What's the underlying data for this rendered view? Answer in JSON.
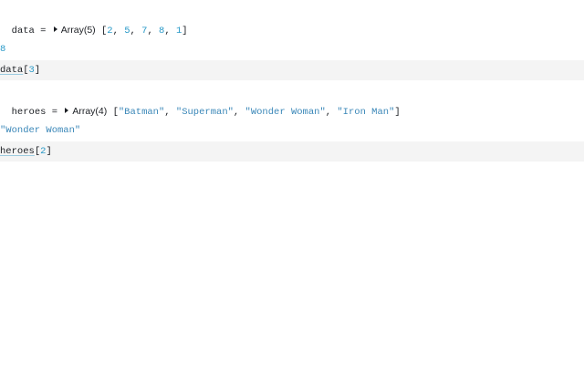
{
  "cells": [
    {
      "output": {
        "name": "data",
        "eq": " = ",
        "summary": "Array(5)",
        "open": "[",
        "values": [
          "2",
          "5",
          "7",
          "8",
          "1"
        ],
        "sep": ", ",
        "close": "]"
      },
      "result": "8",
      "input": {
        "var": "data",
        "index": "3"
      }
    },
    {
      "output": {
        "name": "heroes",
        "eq": " = ",
        "summary": "Array(4)",
        "open": "[",
        "values": [
          "\"Batman\"",
          "\"Superman\"",
          "\"Wonder Woman\"",
          "\"Iron Man\""
        ],
        "sep": ", ",
        "close": "]"
      },
      "result": "\"Wonder Woman\"",
      "input": {
        "var": "heroes",
        "index": "2"
      }
    }
  ],
  "brackets": {
    "open": "[",
    "close": "]"
  },
  "colors": {
    "number": "#2a9ac8",
    "string": "#3a87b8",
    "cell_bg": "#f4f4f4"
  }
}
